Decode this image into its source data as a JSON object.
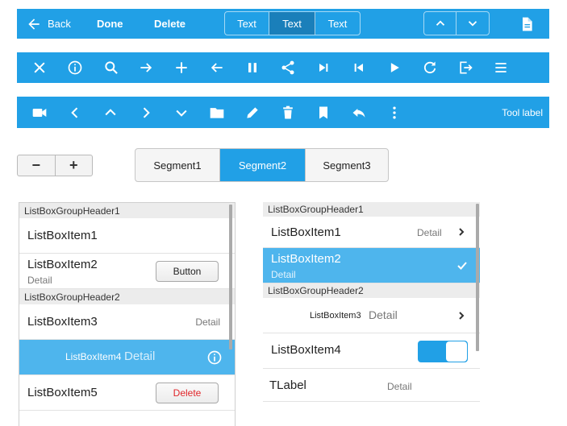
{
  "toolbar1": {
    "back_label": "Back",
    "done_label": "Done",
    "delete_label": "Delete",
    "segments": [
      "Text",
      "Text",
      "Text"
    ],
    "active_segment": 1
  },
  "toolbar3": {
    "tool_label": "Tool label"
  },
  "stepper": {
    "minus": "−",
    "plus": "+"
  },
  "segment_control": {
    "items": [
      "Segment1",
      "Segment2",
      "Segment3"
    ],
    "selected": 1
  },
  "list_left": {
    "group1": "ListBoxGroupHeader1",
    "item1": "ListBoxItem1",
    "item2": "ListBoxItem2",
    "item2_detail": "Detail",
    "item2_button": "Button",
    "group2": "ListBoxGroupHeader2",
    "item3": "ListBoxItem3",
    "item3_detail": "Detail",
    "item4": "ListBoxItem4",
    "item4_detail": "Detail",
    "item5": "ListBoxItem5",
    "item5_button": "Delete"
  },
  "list_right": {
    "group1": "ListBoxGroupHeader1",
    "item1": "ListBoxItem1",
    "item1_detail": "Detail",
    "item2": "ListBoxItem2",
    "item2_detail": "Detail",
    "group2": "ListBoxGroupHeader2",
    "item3": "ListBoxItem3",
    "item3_detail": "Detail",
    "item4": "ListBoxItem4",
    "label": "TLabel",
    "label_detail": "Detail"
  },
  "colors": {
    "accent": "#21a0e6",
    "selected_row": "#4eb5ed",
    "delete": "#e0262a"
  }
}
